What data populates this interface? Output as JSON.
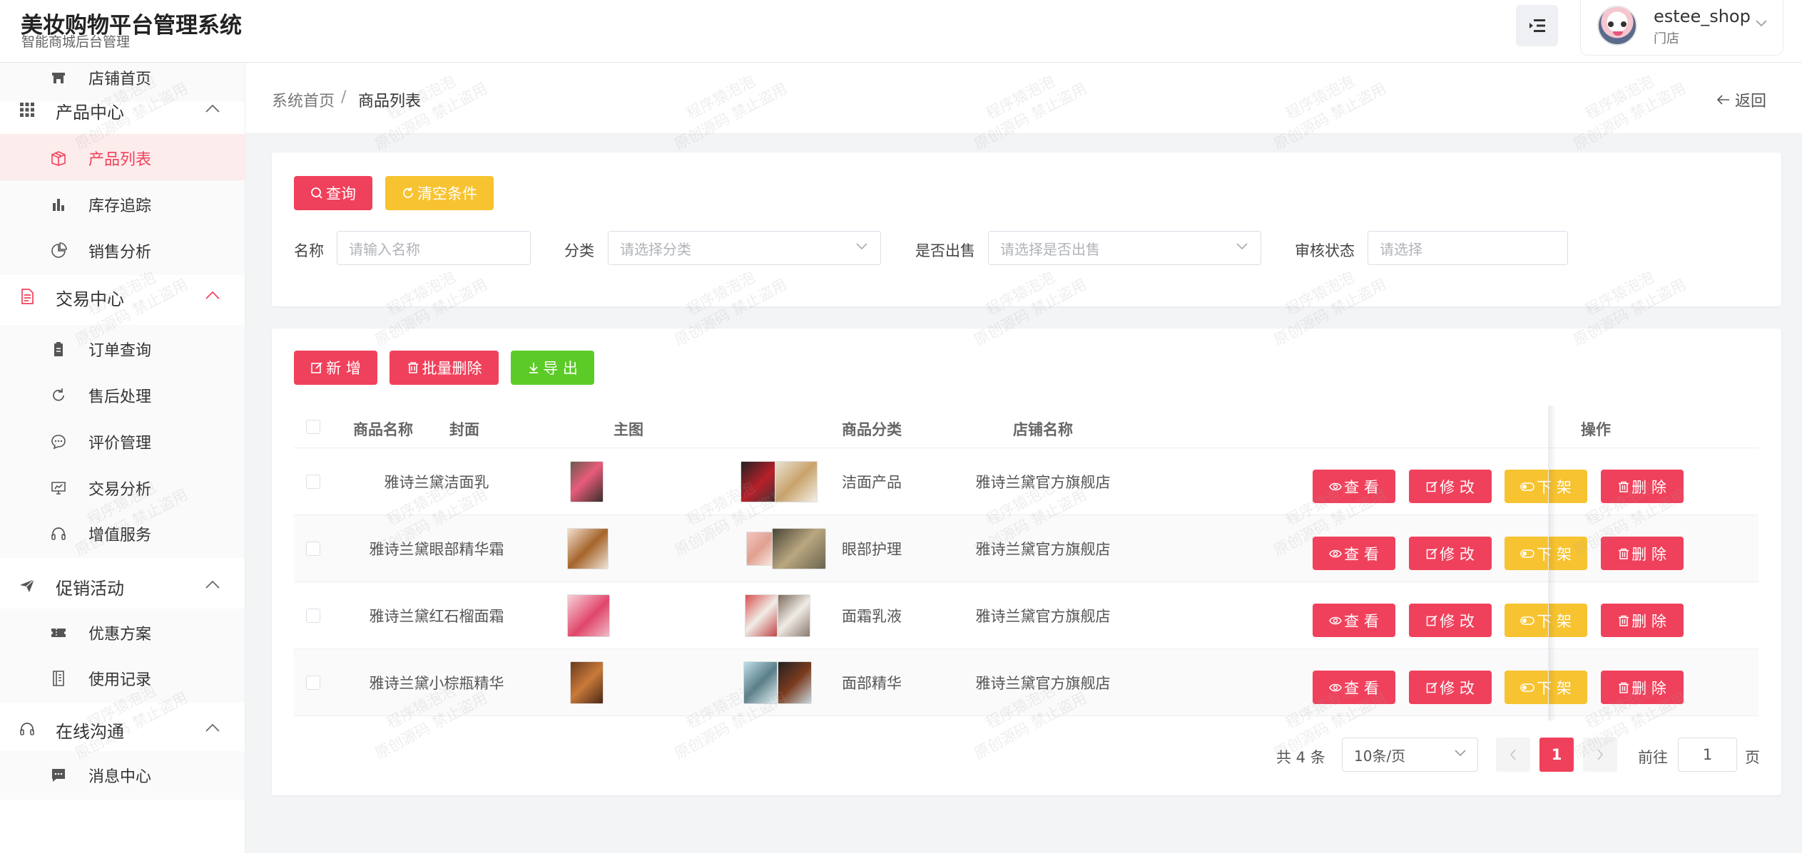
{
  "header": {
    "title": "美妆购物平台管理系统",
    "subtitle": "智能商城后台管理",
    "user": {
      "name": "estee_shop",
      "role": "门店"
    }
  },
  "sidebar": {
    "items": [
      {
        "label": "店铺首页",
        "icon": "store-icon",
        "type": "sub"
      },
      {
        "label": "产品中心",
        "icon": "grid-icon",
        "type": "group",
        "expanded": true
      },
      {
        "label": "产品列表",
        "icon": "box-icon",
        "type": "sub",
        "active": true
      },
      {
        "label": "库存追踪",
        "icon": "bar-chart-icon",
        "type": "sub"
      },
      {
        "label": "销售分析",
        "icon": "pie-chart-icon",
        "type": "sub"
      },
      {
        "label": "交易中心",
        "icon": "document-icon",
        "type": "group",
        "expanded": true,
        "highlight": true
      },
      {
        "label": "订单查询",
        "icon": "clipboard-icon",
        "type": "sub"
      },
      {
        "label": "售后处理",
        "icon": "refresh-icon",
        "type": "sub"
      },
      {
        "label": "评价管理",
        "icon": "chat-bubble-icon",
        "type": "sub"
      },
      {
        "label": "交易分析",
        "icon": "monitor-chart-icon",
        "type": "sub"
      },
      {
        "label": "增值服务",
        "icon": "headset-icon",
        "type": "sub"
      },
      {
        "label": "促销活动",
        "icon": "paper-plane-icon",
        "type": "group",
        "expanded": true
      },
      {
        "label": "优惠方案",
        "icon": "ticket-icon",
        "type": "sub"
      },
      {
        "label": "使用记录",
        "icon": "notebook-icon",
        "type": "sub"
      },
      {
        "label": "在线沟通",
        "icon": "headset-icon",
        "type": "group",
        "expanded": true
      },
      {
        "label": "消息中心",
        "icon": "message-icon",
        "type": "sub"
      }
    ]
  },
  "breadcrumb": {
    "home": "系统首页",
    "separator": "/",
    "current": "商品列表",
    "back": "返回"
  },
  "filter": {
    "query_button": "查询",
    "reset_button": "清空条件",
    "fields": [
      {
        "label": "名称",
        "placeholder": "请输入名称"
      },
      {
        "label": "分类",
        "placeholder": "请选择分类"
      },
      {
        "label": "是否出售",
        "placeholder": "请选择是否出售"
      },
      {
        "label": "审核状态",
        "placeholder": "请选择"
      }
    ]
  },
  "toolbar": {
    "add": "新 增",
    "batch_delete": "批量删除",
    "export": "导 出"
  },
  "table": {
    "columns": [
      "商品名称",
      "封面",
      "主图",
      "商品分类",
      "店铺名称",
      "操作"
    ],
    "actions": {
      "view": "查 看",
      "edit": "修 改",
      "offshelf": "下 架",
      "delete": "删 除"
    },
    "rows": [
      {
        "name": "雅诗兰黛洁面乳",
        "category": "洁面产品",
        "shop": "雅诗兰黛官方旗舰店"
      },
      {
        "name": "雅诗兰黛眼部精华霜",
        "category": "眼部护理",
        "shop": "雅诗兰黛官方旗舰店"
      },
      {
        "name": "雅诗兰黛红石榴面霜",
        "category": "面霜乳液",
        "shop": "雅诗兰黛官方旗舰店"
      },
      {
        "name": "雅诗兰黛小棕瓶精华",
        "category": "面部精华",
        "shop": "雅诗兰黛官方旗舰店"
      }
    ]
  },
  "pagination": {
    "total": "共 4 条",
    "page_size": "10条/页",
    "current_page": "1",
    "goto_label": "前往",
    "goto_value": "1",
    "page_unit": "页"
  },
  "watermark": {
    "line1": "程序猿泡泡",
    "line2": "原创源码 禁止盗用"
  },
  "colors": {
    "primary": "#f0415c",
    "warning": "#f7c331",
    "success": "#5ccb27"
  }
}
